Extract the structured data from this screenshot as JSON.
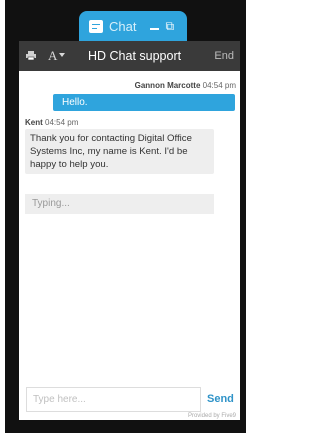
{
  "chat_tab": {
    "label": "Chat",
    "icons": [
      "chat-bubble-icon",
      "minimize-icon",
      "popout-icon"
    ],
    "popout_glyph": "⧉",
    "color": "#2fa4dd"
  },
  "header": {
    "title": "HD Chat support",
    "end_label": "End",
    "font_glyph": "A",
    "icons": [
      "print-icon",
      "font-size-icon"
    ],
    "background": "#3a3a3a"
  },
  "messages": [
    {
      "sender": "Gannon Marcotte",
      "time": "04:54 pm",
      "text": "Hello.",
      "direction": "outgoing"
    },
    {
      "sender": "Kent",
      "time": "04:54 pm",
      "text": "Thank you for contacting Digital Office Systems Inc, my name is Kent. I'd be happy to help you.",
      "direction": "incoming"
    }
  ],
  "typing_indicator": "Typing...",
  "composer": {
    "placeholder": "Type here...",
    "send_label": "Send"
  },
  "footer": {
    "powered_by": "Provided by Five9"
  },
  "colors": {
    "accent": "#2fa4dd",
    "send": "#2f93c8",
    "bubble_in": "#eeeeee"
  }
}
